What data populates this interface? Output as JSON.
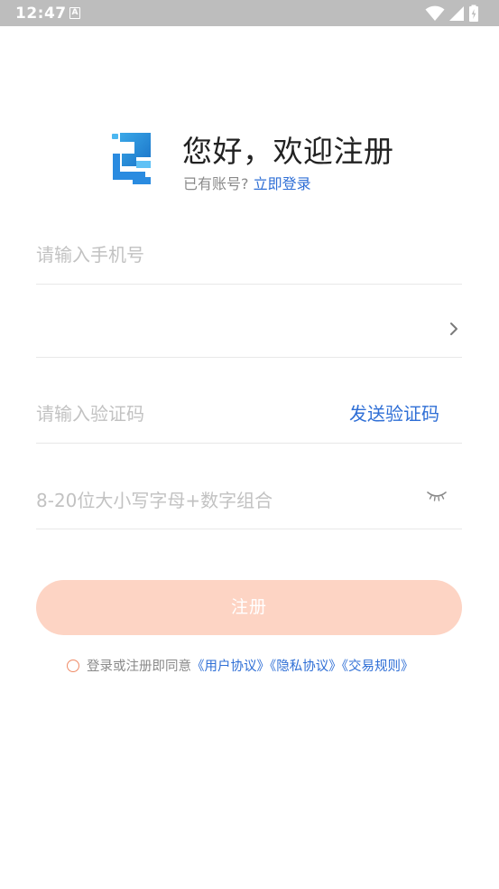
{
  "status_bar": {
    "time": "12:47",
    "notification_icon_letter": "A",
    "icons": [
      "wifi-icon",
      "signal-icon",
      "battery-icon"
    ]
  },
  "header": {
    "title": "您好，欢迎注册",
    "subtitle_prefix": "已有账号?",
    "login_link": "立即登录"
  },
  "form": {
    "phone_placeholder": "请输入手机号",
    "code_placeholder": "请输入验证码",
    "send_code_label": "发送验证码",
    "password_placeholder": "8-20位大小写字母+数字组合"
  },
  "register_button_label": "注册",
  "agreement": {
    "prefix": "登录或注册即同意",
    "user_agreement": "《用户协议》",
    "privacy_agreement": "《隐私协议》",
    "trading_rules": "《交易规则》"
  },
  "colors": {
    "accent_blue": "#2f6fd6",
    "register_button_bg": "#fdd4c4",
    "checkbox_border": "#ef8a66",
    "status_bar_bg": "#bdbdbd"
  }
}
